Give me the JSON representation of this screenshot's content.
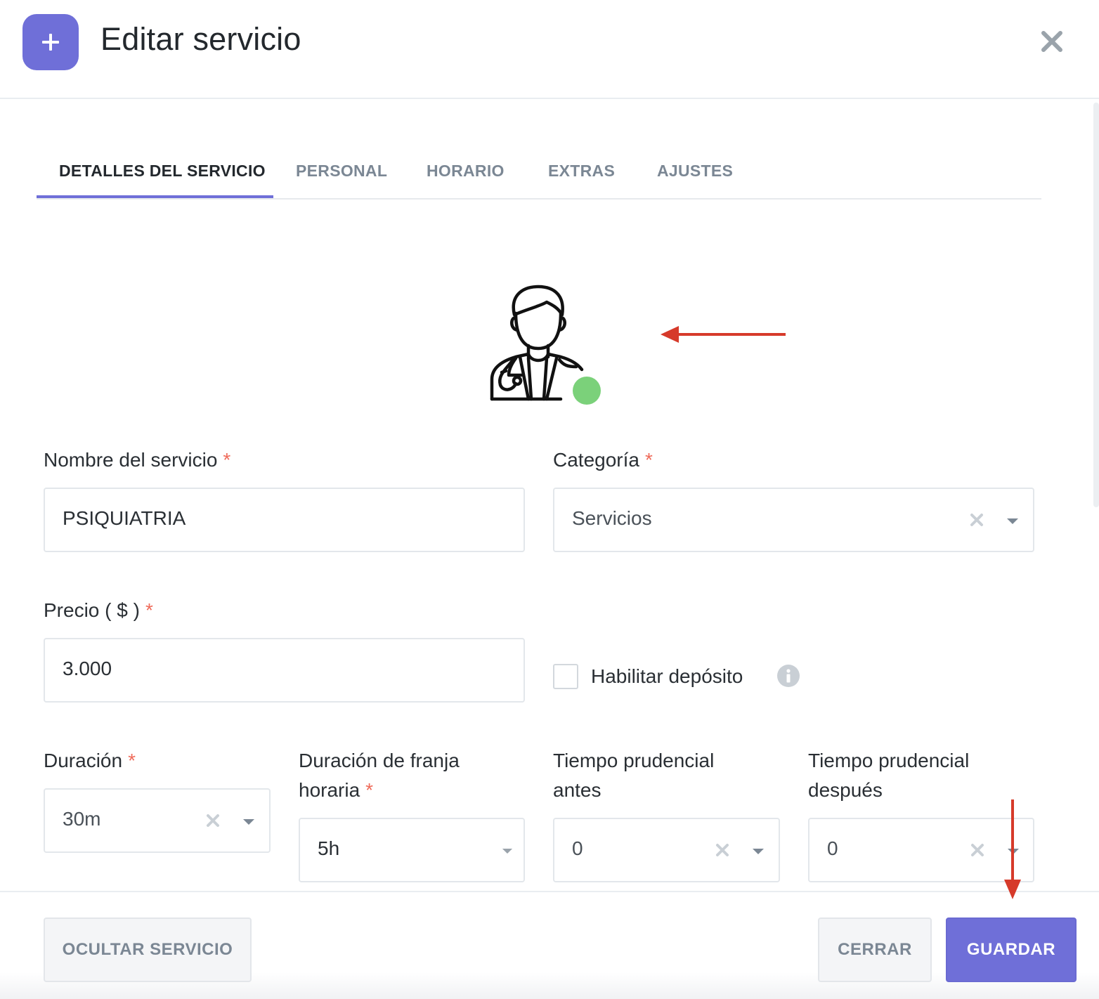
{
  "header": {
    "title": "Editar servicio",
    "add_icon": "plus-icon",
    "close_icon": "close-icon",
    "accent_color": "#6f6fd8"
  },
  "tabs": [
    {
      "label": "DETALLES DEL SERVICIO",
      "active": true
    },
    {
      "label": "PERSONAL",
      "active": false
    },
    {
      "label": "HORARIO",
      "active": false
    },
    {
      "label": "EXTRAS",
      "active": false
    },
    {
      "label": "AJUSTES",
      "active": false
    }
  ],
  "service_image": {
    "icon": "doctor-avatar-icon",
    "status_color": "#7bd17a"
  },
  "form": {
    "name": {
      "label": "Nombre del servicio",
      "required": "*",
      "value": "PSIQUIATRIA"
    },
    "category": {
      "label": "Categoría",
      "required": "*",
      "value": "Servicios"
    },
    "price": {
      "label": "Precio ( $ )",
      "required": "*",
      "value": "3.000"
    },
    "deposit": {
      "label": "Habilitar depósito",
      "checked": false,
      "info_icon": "info-icon"
    },
    "duration": {
      "label": "Duración",
      "required": "*",
      "value": "30m"
    },
    "slot_duration": {
      "label_line1": "Duración de franja",
      "label_line2": "horaria",
      "required": "*",
      "value": "5h"
    },
    "buffer_before": {
      "label_line1": "Tiempo prudencial",
      "label_line2": "antes",
      "value": "0"
    },
    "buffer_after": {
      "label_line1": "Tiempo prudencial",
      "label_line2": "después",
      "value": "0"
    }
  },
  "footer": {
    "hide_label": "OCULTAR SERVICIO",
    "close_label": "CERRAR",
    "save_label": "GUARDAR"
  },
  "annotation_color": "#d63a2a"
}
